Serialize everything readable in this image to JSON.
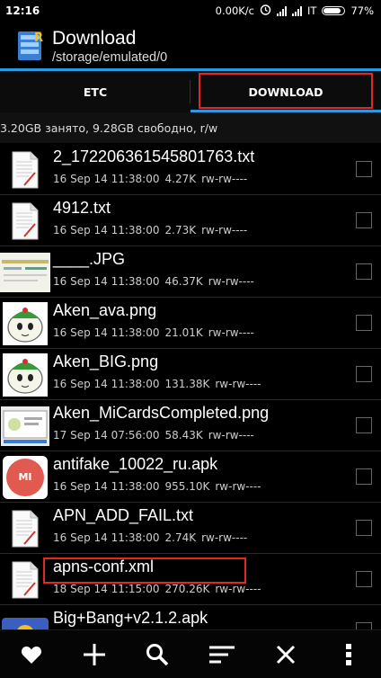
{
  "status_bar": {
    "time": "12:16",
    "speed": "0.00K/c",
    "carrier": "IT",
    "battery": "77%",
    "battery_level": 0.77
  },
  "header": {
    "title": "Download",
    "path": "/storage/emulated/0"
  },
  "tabs": [
    {
      "label": "ETC",
      "active": false
    },
    {
      "label": "DOWNLOAD",
      "active": true
    }
  ],
  "storage_info": "3.20GB занято, 9.28GB свободно, r/w",
  "files": [
    {
      "name": "2_172206361545801763.txt",
      "date": "16 Sep 14 11:38:00",
      "size": "4.27K",
      "perm": "rw-rw----",
      "icon": "text-document-icon"
    },
    {
      "name": "4912.txt",
      "date": "16 Sep 14 11:38:00",
      "size": "2.73K",
      "perm": "rw-rw----",
      "icon": "text-document-icon"
    },
    {
      "name": "____.JPG",
      "date": "16 Sep 14 11:38:00",
      "size": "46.37K",
      "perm": "rw-rw----",
      "icon": "image-thumbnail"
    },
    {
      "name": "Aken_ava.png",
      "date": "16 Sep 14 11:38:00",
      "size": "21.01K",
      "perm": "rw-rw----",
      "icon": "mascot-thumbnail"
    },
    {
      "name": "Aken_BIG.png",
      "date": "16 Sep 14 11:38:00",
      "size": "131.38K",
      "perm": "rw-rw----",
      "icon": "mascot-thumbnail"
    },
    {
      "name": "Aken_MiCardsCompleted.png",
      "date": "17 Sep 14 07:56:00",
      "size": "58.43K",
      "perm": "rw-rw----",
      "icon": "screenshot-thumbnail"
    },
    {
      "name": "antifake_10022_ru.apk",
      "date": "16 Sep 14 11:38:00",
      "size": "955.10K",
      "perm": "rw-rw----",
      "icon": "mi-app-icon"
    },
    {
      "name": "APN_ADD_FAIL.txt",
      "date": "16 Sep 14 11:38:00",
      "size": "2.74K",
      "perm": "rw-rw----",
      "icon": "text-document-icon"
    },
    {
      "name": "apns-conf.xml",
      "date": "18 Sep 14 11:15:00",
      "size": "270.26K",
      "perm": "rw-rw----",
      "icon": "text-document-icon"
    },
    {
      "name": "Big+Bang+v2.1.2.apk",
      "date": "",
      "size": "",
      "perm": "",
      "icon": "game-app-icon"
    }
  ],
  "toolbar": [
    {
      "icon": "heart-icon"
    },
    {
      "icon": "plus-icon"
    },
    {
      "icon": "search-icon"
    },
    {
      "icon": "sort-icon"
    },
    {
      "icon": "close-icon"
    },
    {
      "icon": "more-vert-icon"
    }
  ],
  "colors": {
    "accent": "#2a9be0",
    "highlight": "#e02828",
    "background": "#000000"
  }
}
